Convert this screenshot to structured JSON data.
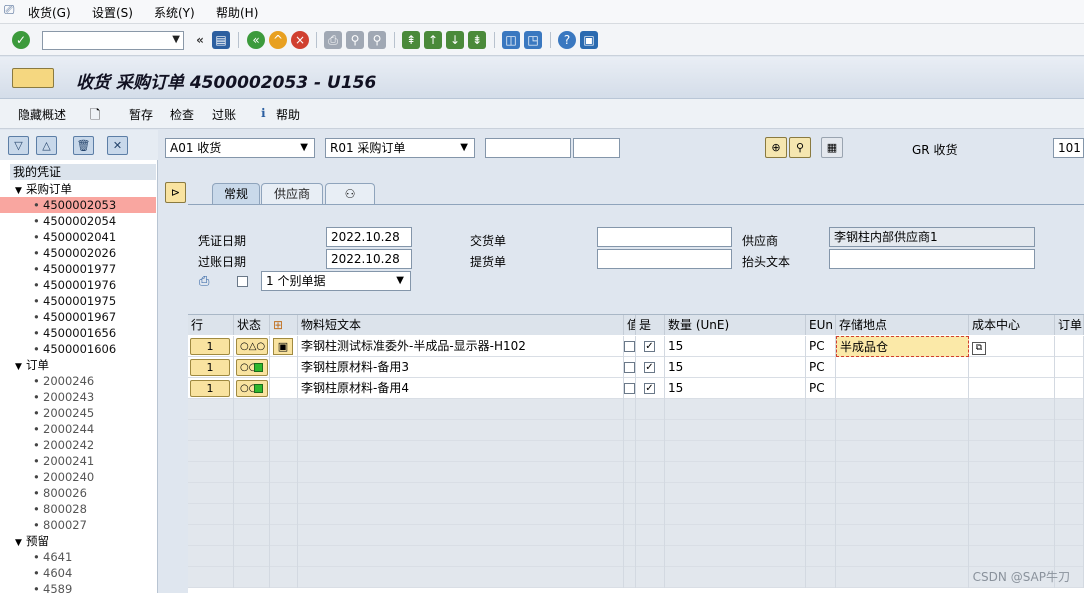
{
  "menubar": {
    "items": [
      "收货(G)",
      "设置(S)",
      "系统(Y)",
      "帮助(H)"
    ]
  },
  "toolbar": {
    "command_value": "",
    "icons": [
      "enter-icon",
      "back-icon",
      "save-icon",
      "back-green-icon",
      "exit-icon",
      "cancel-icon",
      "print-icon",
      "find-icon",
      "find-next-icon",
      "first-page-icon",
      "prev-page-icon",
      "next-page-icon",
      "last-page-icon",
      "new-session-icon",
      "shortcut-icon",
      "help-icon",
      "layout-icon"
    ]
  },
  "title": "收货 采购订单 4500002053 - U156",
  "app_toolbar": {
    "hide_overview": "隐藏概述",
    "hold": "暂存",
    "check": "检查",
    "post": "过账",
    "help": "帮助"
  },
  "nav": {
    "header": "我的凭证",
    "purchase_orders_label": "采购订单",
    "purchase_orders": [
      "4500002053",
      "4500002054",
      "4500002041",
      "4500002026",
      "4500001977",
      "4500001976",
      "4500001975",
      "4500001967",
      "4500001656",
      "4500001606"
    ],
    "orders_label": "订单",
    "orders": [
      "2000246",
      "2000243",
      "2000245",
      "2000244",
      "2000242",
      "2000241",
      "2000240",
      "800026",
      "800028",
      "800027"
    ],
    "reservations_label": "预留",
    "reservations": [
      "4641",
      "4604",
      "4589"
    ]
  },
  "header": {
    "action_select": "A01 收货",
    "reference_select": "R01 采购订单",
    "ref_input1": "",
    "ref_input2": "",
    "gr_label": "GR 收货",
    "movement_type": "101"
  },
  "tabs": [
    "常规",
    "供应商"
  ],
  "general": {
    "doc_date_label": "凭证日期",
    "doc_date": "2022.10.28",
    "post_date_label": "过账日期",
    "post_date": "2022.10.28",
    "delivery_note_label": "交货单",
    "delivery_note": "",
    "bill_of_lading_label": "提货单",
    "bill_of_lading": "",
    "vendor_label": "供应商",
    "vendor": "李钢柱内部供应商1",
    "header_text_label": "抬头文本",
    "header_text": "",
    "slip_select": "1 个别单据"
  },
  "grid": {
    "headers": [
      "行",
      "状态",
      "",
      "物料短文本",
      "值",
      "是",
      "数量 (UnE)",
      "EUn",
      "存储地点",
      "成本中心",
      "订单"
    ],
    "rows": [
      {
        "line": "1",
        "text": "李钢柱测试标准委外-半成品-显示器-H102",
        "ok": "✓",
        "qty": "15",
        "unit": "PC",
        "sloc": "半成品仓"
      },
      {
        "line": "1",
        "text": "李钢柱原材料-备用3",
        "ok": "✓",
        "qty": "15",
        "unit": "PC",
        "sloc": ""
      },
      {
        "line": "1",
        "text": "李钢柱原材料-备用4",
        "ok": "✓",
        "qty": "15",
        "unit": "PC",
        "sloc": ""
      }
    ]
  },
  "watermark": "CSDN @SAP牛刀",
  "colors": {
    "selected_row": "#f9a6a0",
    "button_yellow": "#f9e3a0",
    "accent_blue": "#5c7ea6"
  }
}
